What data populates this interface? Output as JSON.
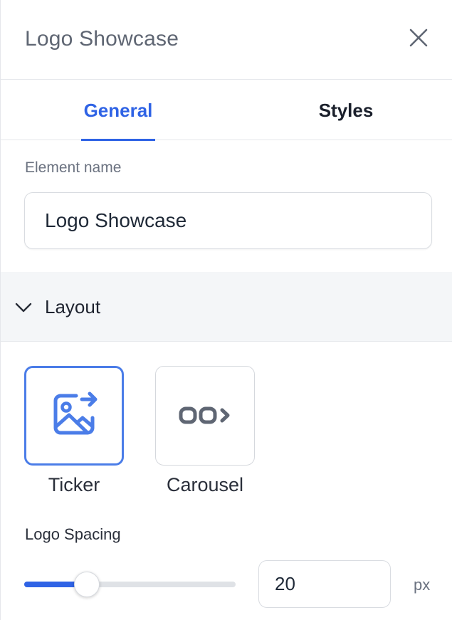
{
  "panel": {
    "title": "Logo Showcase"
  },
  "tabs": [
    {
      "label": "General",
      "active": true
    },
    {
      "label": "Styles",
      "active": false
    }
  ],
  "element_name": {
    "label": "Element name",
    "value": "Logo Showcase"
  },
  "layout": {
    "section_title": "Layout",
    "expanded": true,
    "options": [
      {
        "label": "Ticker",
        "icon": "image-arrow-icon",
        "selected": true
      },
      {
        "label": "Carousel",
        "icon": "carousel-icon",
        "selected": false
      }
    ]
  },
  "logo_spacing": {
    "label": "Logo Spacing",
    "value": "20",
    "unit": "px",
    "slider_fraction": 0.235
  },
  "colors": {
    "accent": "#2f63e5",
    "selected_border": "#4b7de8",
    "icon_gray": "#5f6673"
  }
}
